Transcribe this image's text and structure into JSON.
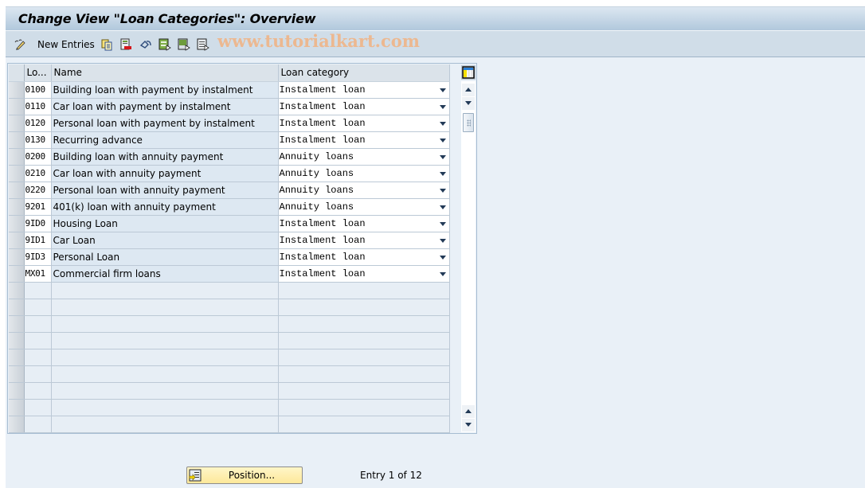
{
  "window": {
    "title": "Change View \"Loan Categories\": Overview"
  },
  "toolbar": {
    "new_entries_label": "New Entries",
    "icons": [
      {
        "name": "change-display-icon"
      },
      {
        "name": "copy-as-icon"
      },
      {
        "name": "delete-icon"
      },
      {
        "name": "undo-change-icon"
      },
      {
        "name": "select-all-icon"
      },
      {
        "name": "select-block-icon"
      },
      {
        "name": "deselect-all-icon"
      }
    ],
    "watermark": "www.tutorialkart.com"
  },
  "table": {
    "columns": [
      {
        "key": "code",
        "label": "Lo..."
      },
      {
        "key": "name",
        "label": "Name"
      },
      {
        "key": "category",
        "label": "Loan category"
      }
    ],
    "rows": [
      {
        "code": "0100",
        "name": "Building loan with payment by instalment",
        "category": "Instalment loan"
      },
      {
        "code": "0110",
        "name": "Car loan with payment by instalment",
        "category": "Instalment loan"
      },
      {
        "code": "0120",
        "name": "Personal loan with payment by instalment",
        "category": "Instalment loan"
      },
      {
        "code": "0130",
        "name": "Recurring advance",
        "category": "Instalment loan"
      },
      {
        "code": "0200",
        "name": "Building loan with annuity payment",
        "category": "Annuity loans"
      },
      {
        "code": "0210",
        "name": "Car loan with annuity payment",
        "category": "Annuity loans"
      },
      {
        "code": "0220",
        "name": "Personal loan with annuity payment",
        "category": "Annuity loans"
      },
      {
        "code": "9201",
        "name": "401(k) loan with annuity payment",
        "category": "Annuity loans"
      },
      {
        "code": "9ID0",
        "name": "Housing Loan",
        "category": "Instalment loan"
      },
      {
        "code": "9ID1",
        "name": "Car Loan",
        "category": "Instalment loan"
      },
      {
        "code": "9ID3",
        "name": "Personal Loan",
        "category": "Instalment loan"
      },
      {
        "code": "MX01",
        "name": "Commercial firm loans",
        "category": "Instalment loan"
      }
    ],
    "empty_rows": 9
  },
  "footer": {
    "position_button_label": "Position...",
    "entry_info": "Entry 1 of 12"
  }
}
